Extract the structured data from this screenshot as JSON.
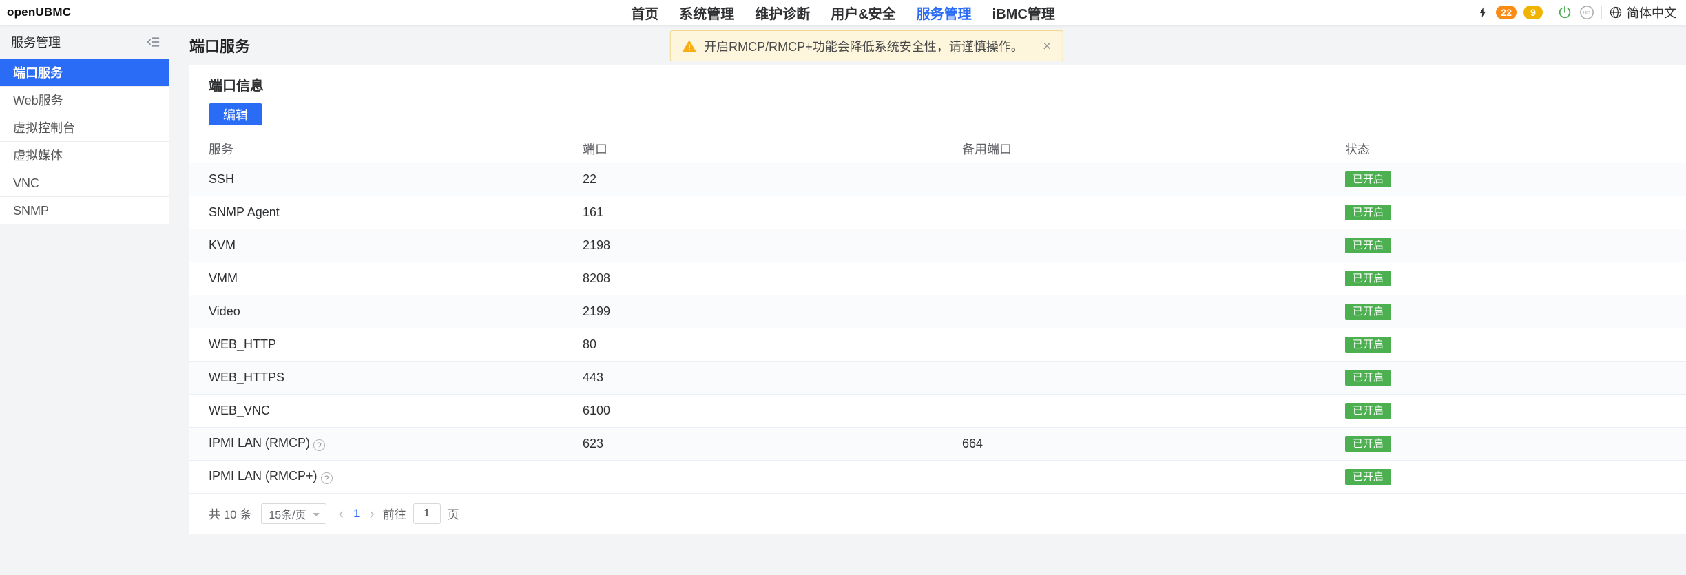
{
  "header": {
    "logo": "openUBMC",
    "nav": [
      {
        "label": "首页",
        "active": false
      },
      {
        "label": "系统管理",
        "active": false
      },
      {
        "label": "维护诊断",
        "active": false
      },
      {
        "label": "用户&安全",
        "active": false
      },
      {
        "label": "服务管理",
        "active": true
      },
      {
        "label": "iBMC管理",
        "active": false
      }
    ],
    "alarm_badges": [
      {
        "count": "22",
        "color": "#fa8c16"
      },
      {
        "count": "9",
        "color": "#f0b400"
      }
    ],
    "language": "简体中文"
  },
  "sidebar": {
    "title": "服务管理",
    "items": [
      {
        "label": "端口服务",
        "active": true
      },
      {
        "label": "Web服务",
        "active": false
      },
      {
        "label": "虚拟控制台",
        "active": false
      },
      {
        "label": "虚拟媒体",
        "active": false
      },
      {
        "label": "VNC",
        "active": false
      },
      {
        "label": "SNMP",
        "active": false
      }
    ]
  },
  "page": {
    "title": "端口服务",
    "alert": {
      "text": "开启RMCP/RMCP+功能会降低系统安全性，请谨慎操作。",
      "close": "×"
    },
    "card": {
      "section_title": "端口信息",
      "edit_button": "编辑",
      "table": {
        "columns": [
          "服务",
          "端口",
          "备用端口",
          "状态"
        ],
        "rows": [
          {
            "service": "SSH",
            "port": "22",
            "alt_port": "",
            "status": "已开启",
            "help": false
          },
          {
            "service": "SNMP Agent",
            "port": "161",
            "alt_port": "",
            "status": "已开启",
            "help": false
          },
          {
            "service": "KVM",
            "port": "2198",
            "alt_port": "",
            "status": "已开启",
            "help": false
          },
          {
            "service": "VMM",
            "port": "8208",
            "alt_port": "",
            "status": "已开启",
            "help": false
          },
          {
            "service": "Video",
            "port": "2199",
            "alt_port": "",
            "status": "已开启",
            "help": false
          },
          {
            "service": "WEB_HTTP",
            "port": "80",
            "alt_port": "",
            "status": "已开启",
            "help": false
          },
          {
            "service": "WEB_HTTPS",
            "port": "443",
            "alt_port": "",
            "status": "已开启",
            "help": false
          },
          {
            "service": "WEB_VNC",
            "port": "6100",
            "alt_port": "",
            "status": "已开启",
            "help": false
          },
          {
            "service": "IPMI LAN (RMCP)",
            "port": "623",
            "alt_port": "664",
            "status": "已开启",
            "help": true
          },
          {
            "service": "IPMI LAN (RMCP+)",
            "port": "",
            "alt_port": "",
            "status": "已开启",
            "help": true
          }
        ]
      },
      "pagination": {
        "total": "共 10 条",
        "page_size": "15条/页",
        "prev": "‹",
        "current": "1",
        "next": "›",
        "goto_label": "前往",
        "goto_value": "1",
        "unit_label": "页"
      }
    }
  },
  "icons": {
    "help": "?"
  },
  "colors": {
    "primary": "#2a6cf5",
    "success_badge": "#4caf50",
    "warning_bg": "#fdf6dc",
    "warning_border": "#f2d88f",
    "warning_icon": "#faad14"
  }
}
